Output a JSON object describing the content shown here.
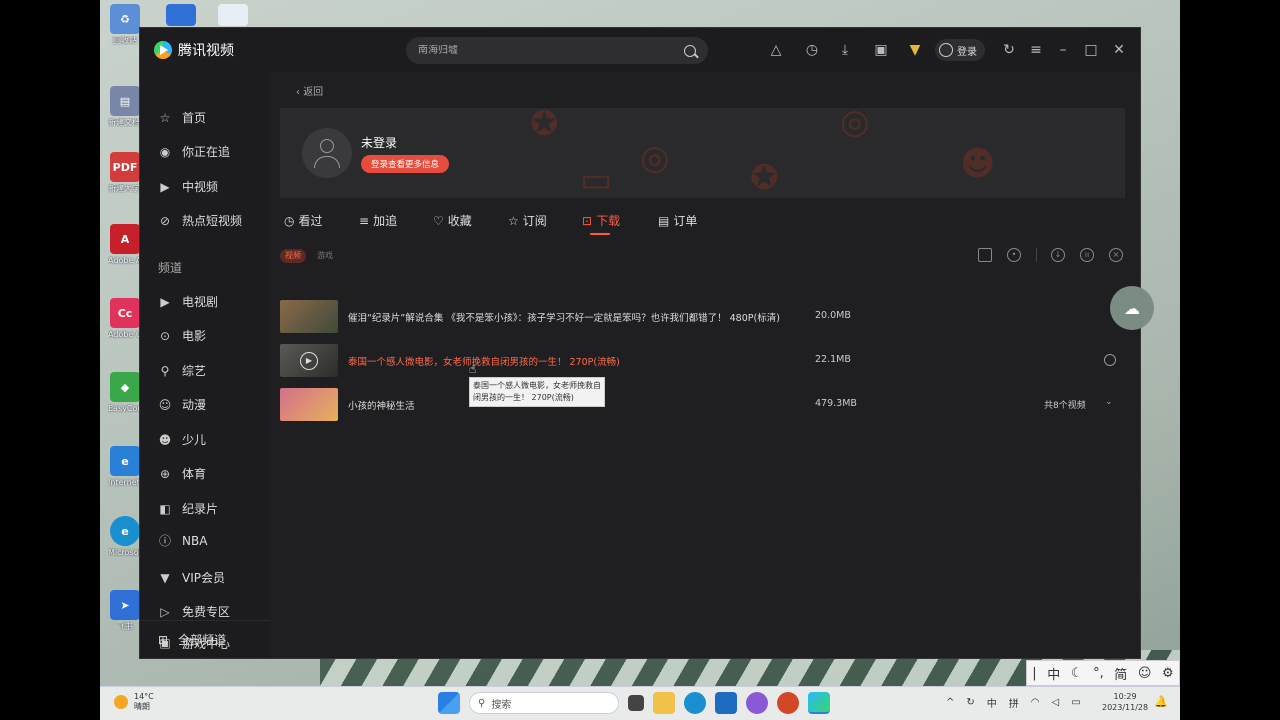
{
  "desktop": {
    "icons": [
      {
        "label": "回收站",
        "color": "#5d8fd6"
      },
      {
        "label": "新建文档 2023-1",
        "color": "#7a86a8"
      },
      {
        "label": "新建大学 报告",
        "color": "#d23c3c"
      },
      {
        "label": "Adobe Acrobat",
        "color": "#c8202a"
      },
      {
        "label": "Adobe Creative",
        "color": "#e0325a"
      },
      {
        "label": "EasyConn",
        "color": "#3aa84a"
      },
      {
        "label": "Internet Explorer",
        "color": "#2a7fd6"
      },
      {
        "label": "Microsoft Edge",
        "color": "#1a8fcf"
      },
      {
        "label": "飞书",
        "color": "#2f6fd6"
      }
    ]
  },
  "app": {
    "name": "腾讯视频",
    "search": {
      "placeholder": "南海归墟"
    },
    "login_label": "登录",
    "toolbar_icons": [
      "cloud-icon",
      "history-icon",
      "download-icon",
      "game-icon",
      "vip-icon"
    ],
    "window_controls": [
      "refresh-icon",
      "menu-icon",
      "minimize-icon",
      "maximize-icon",
      "close-icon"
    ]
  },
  "sidebar": {
    "items": [
      {
        "label": "首页",
        "icon": "star-icon"
      },
      {
        "label": "你正在追",
        "icon": "eye-icon"
      },
      {
        "label": "中视频",
        "icon": "play-square-icon"
      },
      {
        "label": "热点短视频",
        "icon": "compass-icon"
      }
    ],
    "section_label": "频道",
    "channels": [
      {
        "label": "电视剧",
        "icon": "tv-icon"
      },
      {
        "label": "电影",
        "icon": "film-icon"
      },
      {
        "label": "综艺",
        "icon": "mic-icon"
      },
      {
        "label": "动漫",
        "icon": "anime-icon"
      },
      {
        "label": "少儿",
        "icon": "kid-icon"
      },
      {
        "label": "体育",
        "icon": "ball-icon"
      },
      {
        "label": "纪录片",
        "icon": "camera-icon"
      },
      {
        "label": "NBA",
        "icon": "nba-icon"
      },
      {
        "label": "VIP会员",
        "icon": "vip-icon"
      },
      {
        "label": "免费专区",
        "icon": "free-icon"
      },
      {
        "label": "游戏中心",
        "icon": "gamepad-icon"
      }
    ],
    "bottom_label": "全部频道"
  },
  "main": {
    "back_label": "返回",
    "profile": {
      "name": "未登录",
      "button": "登录查看更多信息"
    },
    "tabs": [
      {
        "label": "看过",
        "icon": "clock-icon"
      },
      {
        "label": "加追",
        "icon": "list-icon"
      },
      {
        "label": "收藏",
        "icon": "heart-icon"
      },
      {
        "label": "订阅",
        "icon": "star-icon"
      },
      {
        "label": "下载",
        "icon": "download-icon",
        "active": true
      },
      {
        "label": "订单",
        "icon": "order-icon"
      }
    ],
    "subtabs": [
      {
        "label": "视频",
        "active": true
      },
      {
        "label": "游戏"
      }
    ],
    "action_icons": [
      "folder-icon",
      "settings-icon",
      "download-all-icon",
      "pause-all-icon",
      "clear-icon"
    ],
    "downloads": [
      {
        "title": "催泪“纪录片”解说合集 《我不是笨小孩》：孩子学习不好一定就是笨吗？也许我们都错了！ 480P(标清)",
        "size": "20.0MB",
        "thumb_color": "#6b5a4a"
      },
      {
        "title": "泰国一个感人微电影，女老师挽救自闭男孩的一生！ 270P(流畅)",
        "size": "22.1MB",
        "thumb_color": "#4a4a48"
      },
      {
        "title": "小孩的神秘生活",
        "size": "479.3MB",
        "extra": "共8个视频",
        "thumb_color": "#c8567a"
      }
    ],
    "tooltip": "泰国一个感人微电影，女老师挽救自闭男孩的一生！ 270P(流畅)"
  },
  "ime": {
    "items": [
      "中",
      "简"
    ]
  },
  "taskbar": {
    "weather_temp": "14°C",
    "weather_text": "晴朗",
    "search_label": "搜索",
    "tray": [
      "中",
      "拼"
    ],
    "time": "10:29",
    "date": "2023/11/28"
  }
}
